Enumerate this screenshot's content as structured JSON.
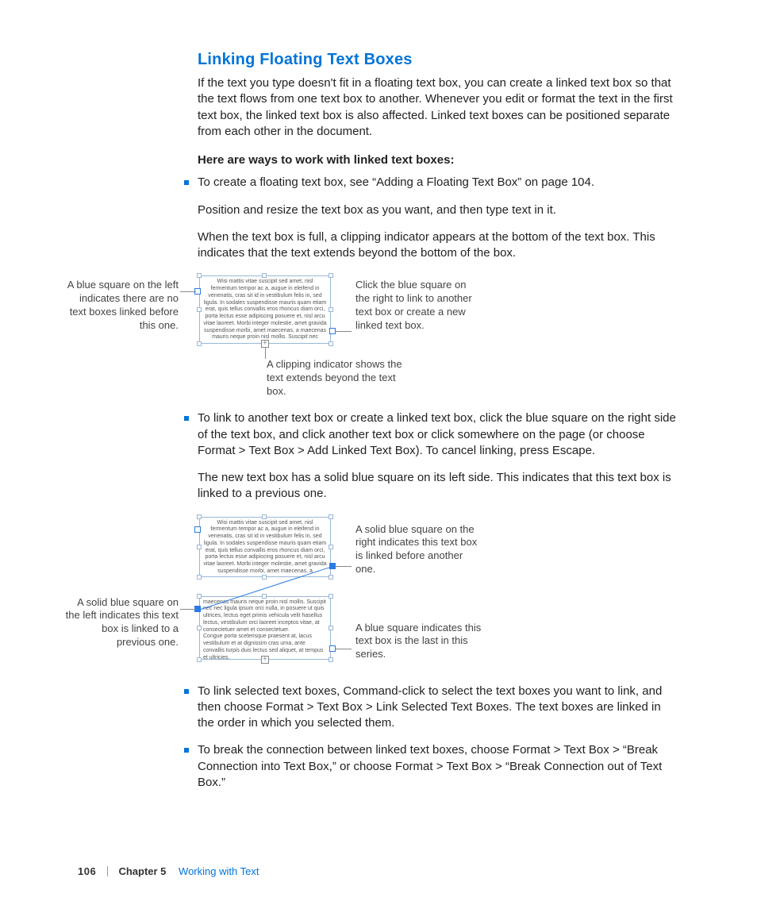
{
  "heading": "Linking Floating Text Boxes",
  "intro": "If the text you type doesn't fit in a floating text box, you can create a linked text box so that the text flows from one text box to another. Whenever you edit or format the text in the first text box, the linked text box is also affected. Linked text boxes can be positioned separate from each other in the document.",
  "subhead": "Here are ways to work with linked text boxes:",
  "bullets": {
    "b1": "To create a floating text box, see “Adding a Floating Text Box” on page 104.",
    "b1p2": "Position and resize the text box as you want, and then type text in it.",
    "b1p3": "When the text box is full, a clipping indicator appears at the bottom of the text box. This indicates that the text extends beyond the bottom of the box.",
    "b2": "To link to another text box or create a linked text box, click the blue square on the right side of the text box, and click another text box or click somewhere on the page (or choose Format > Text Box > Add Linked Text Box). To cancel linking, press Escape.",
    "b2p2": "The new text box has a solid blue square on its left side. This indicates that this text box is linked to a previous one.",
    "b3": "To link selected text boxes, Command-click to select the text boxes you want to link, and then choose Format > Text Box > Link Selected Text Boxes. The text boxes are linked in the order in which you selected them.",
    "b4": "To break the connection between linked text boxes, choose Format > Text Box > “Break Connection into Text Box,” or choose Format > Text Box > “Break Connection out of Text Box.”"
  },
  "fig1": {
    "lorem": "Wisi mattis vitae suscipit sed amet, nisl fermentum tempor ac a, augue in eleifend in venenatis, cras sit id in vestibulum felis in, sed ligula. In sodales suspendisse mauris quam etiam erat, quis tellus convallis eros rhoncus diam orci, porta lectus esse adipiscing posuere et, nisl arcu vitae laoreet. Morbi integer molestie, amet gravida suspendisse morbi, amet maecenas, a maecenas mauris neque proin nisl mollis. Suscipit nec",
    "callout_left": "A blue square on the left indicates there are no text boxes linked before this one.",
    "callout_right": "Click the blue square on the right to link to another text box or create a new linked text box.",
    "callout_bottom": "A clipping indicator shows the text extends beyond the text box."
  },
  "fig2": {
    "lorem1": "Wisi mattis vitae suscipit sed amet, nisl fermentum tempor ac a, augue in eleifend in venenatis, cras sit id in vestibulum felis in, sed ligula. In sodales suspendisse mauris quam etiam erat, quis tellus convallis eros rhoncus diam orci, porta lectus esse adipiscing posuere et, nisl arcu vitae laoreet. Morbi integer molestie, amet gravida suspendisse morbi, amet maecenas, a",
    "lorem2": "maecenas mauris neque proin nisl mollis. Suscipit nec nec ligula ipsum orci nulla, in posuere ut quis ultrices, lectus eget primis vehicula velit hasellus lectus, vestibulum orci laoreet inceptos vitae, at consectetuer amet et consectetuer.\n    Congue porta scelerisque praesent at, lacus vestibulum et at dignissim cras urna, ante convallis turpis duis lectus sed aliquet, at tempus et ultricies.",
    "callout_tr": "A solid blue square on the right indicates this text box is linked before another one.",
    "callout_bl": "A solid blue square on the left indicates this text box is linked to a previous one.",
    "callout_br": "A blue square indicates this text box is the last in this series."
  },
  "footer": {
    "page": "106",
    "chapter": "Chapter 5",
    "title": "Working with Text"
  }
}
